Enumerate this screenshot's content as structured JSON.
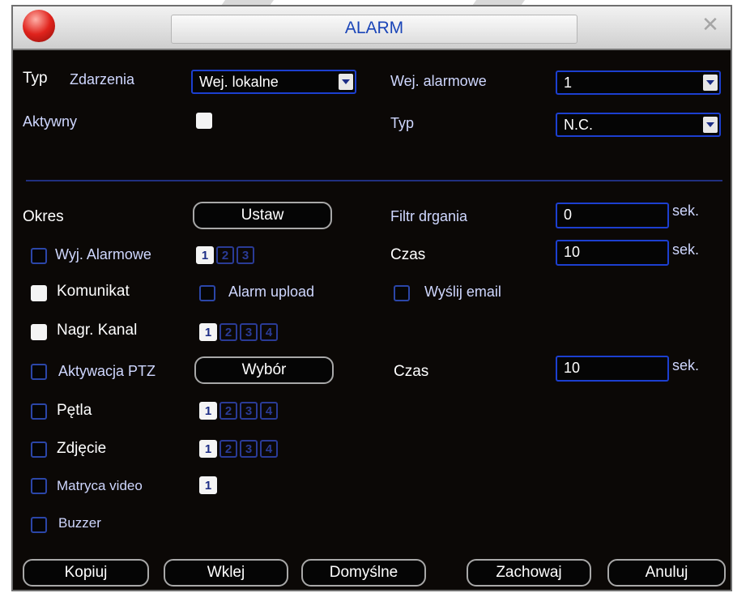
{
  "window": {
    "title": "ALARM"
  },
  "event": {
    "typ_label": "Typ",
    "zdarzenia_label": "Zdarzenia",
    "event_type_value": "Wej. lokalne",
    "aktywny_label": "Aktywny",
    "alarm_input_label": "Wej. alarmowe",
    "alarm_input_value": "1",
    "typ2_label": "Typ",
    "typ2_value": "N.C."
  },
  "settings": {
    "okres_label": "Okres",
    "ustaw_label": "Ustaw",
    "filter_label": "Filtr drgania",
    "filter_value": "0",
    "filter_unit": "sek.",
    "wyj_label": "Wyj. Alarmowe",
    "czas1_label": "Czas",
    "czas1_value": "10",
    "czas1_unit": "sek.",
    "komunikat_label": "Komunikat",
    "alarm_upload_label": "Alarm upload",
    "email_label": "Wyślij email",
    "nagr_label": "Nagr. Kanal",
    "ptz_label": "Aktywacja PTZ",
    "wybor_label": "Wybór",
    "czas2_label": "Czas",
    "czas2_value": "10",
    "czas2_unit": "sek.",
    "petla_label": "Pętla",
    "zdjecie_label": "Zdjęcie",
    "matryca_label": "Matryca video",
    "buzzer_label": "Buzzer",
    "channels_wyj": [
      "1",
      "2",
      "3"
    ],
    "channels_nagr": [
      "1",
      "2",
      "3",
      "4"
    ],
    "channels_petla": [
      "1",
      "2",
      "3",
      "4"
    ],
    "channels_zdjecie": [
      "1",
      "2",
      "3",
      "4"
    ],
    "channels_matryca": [
      "1"
    ]
  },
  "footer": {
    "kopiuj": "Kopiuj",
    "wklej": "Wklej",
    "domyslne": "Domyślne",
    "zachowaj": "Zachowaj",
    "anuluj": "Anuluj"
  }
}
